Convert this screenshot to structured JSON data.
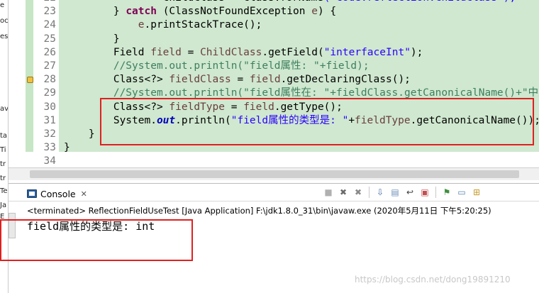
{
  "left_strip": {
    "fragments": [
      "e",
      "oc",
      "es",
      "av",
      "ta",
      "Ti",
      "tr",
      "tr",
      "Te",
      "Ja",
      "E"
    ]
  },
  "editor": {
    "lines": [
      {
        "n": "22",
        "parts": [
          {
            "t": "                ChildClass = Class.",
            "c": ""
          },
          {
            "t": "forName",
            "c": "ital"
          },
          {
            "t": "(\"code.reflection.ChildClass\");",
            "c": "str"
          }
        ]
      },
      {
        "n": "23",
        "parts": [
          {
            "t": "        } ",
            "c": ""
          },
          {
            "t": "catch",
            "c": "kw"
          },
          {
            "t": " (ClassNotFoundException ",
            "c": ""
          },
          {
            "t": "e",
            "c": "var"
          },
          {
            "t": ") {",
            "c": ""
          }
        ]
      },
      {
        "n": "24",
        "parts": [
          {
            "t": "            ",
            "c": ""
          },
          {
            "t": "e",
            "c": "var"
          },
          {
            "t": ".printStackTrace();",
            "c": ""
          }
        ]
      },
      {
        "n": "25",
        "parts": [
          {
            "t": "        }",
            "c": ""
          }
        ]
      },
      {
        "n": "26",
        "parts": [
          {
            "t": "        Field ",
            "c": ""
          },
          {
            "t": "field",
            "c": "var"
          },
          {
            "t": " = ",
            "c": ""
          },
          {
            "t": "ChildClass",
            "c": "var"
          },
          {
            "t": ".getField(",
            "c": ""
          },
          {
            "t": "\"interfaceInt\"",
            "c": "str"
          },
          {
            "t": ");",
            "c": ""
          }
        ]
      },
      {
        "n": "27",
        "parts": [
          {
            "t": "        //System.out.println(\"field属性: \"+field);",
            "c": "cmt"
          }
        ]
      },
      {
        "n": "28",
        "parts": [
          {
            "t": "        Class<?> ",
            "c": ""
          },
          {
            "t": "fieldClass",
            "c": "var"
          },
          {
            "t": " = ",
            "c": ""
          },
          {
            "t": "field",
            "c": "var"
          },
          {
            "t": ".getDeclaringClass();",
            "c": ""
          }
        ]
      },
      {
        "n": "29",
        "parts": [
          {
            "t": "        //System.out.println(\"field属性在: \"+fieldClass.getCanonicalName()+\"中定义\");",
            "c": "cmt"
          }
        ]
      },
      {
        "n": "30",
        "parts": [
          {
            "t": "        Class<?> ",
            "c": ""
          },
          {
            "t": "fieldType",
            "c": "var"
          },
          {
            "t": " = ",
            "c": ""
          },
          {
            "t": "field",
            "c": "var"
          },
          {
            "t": ".getType();",
            "c": ""
          }
        ]
      },
      {
        "n": "31",
        "parts": [
          {
            "t": "        System.",
            "c": ""
          },
          {
            "t": "out",
            "c": "fld"
          },
          {
            "t": ".println(",
            "c": ""
          },
          {
            "t": "\"field属性的类型是: \"",
            "c": "str"
          },
          {
            "t": "+",
            "c": ""
          },
          {
            "t": "fieldType",
            "c": "var"
          },
          {
            "t": ".getCanonicalName());",
            "c": ""
          }
        ]
      },
      {
        "n": "32",
        "parts": [
          {
            "t": "    }",
            "c": ""
          }
        ]
      },
      {
        "n": "33",
        "parts": [
          {
            "t": "}",
            "c": ""
          }
        ]
      },
      {
        "n": "34",
        "parts": [
          {
            "t": "",
            "c": ""
          }
        ]
      }
    ]
  },
  "console": {
    "tab_label": "Console",
    "tab_close": "✕",
    "terminated_text": "<terminated> ReflectionFieldUseTest [Java Application] F:\\jdk1.8.0_31\\bin\\javaw.exe (2020年5月11日 下午5:20:25)",
    "output_text": "field属性的类型是: int",
    "toolbar_icons": [
      {
        "name": "terminate-icon",
        "glyph": "■",
        "color": "#b0b0b0"
      },
      {
        "name": "remove-launch-icon",
        "glyph": "✖",
        "color": "#6b6b6b"
      },
      {
        "name": "remove-all-icon",
        "glyph": "✖",
        "color": "#8a8a8a"
      },
      {
        "name": "scroll-lock-icon",
        "glyph": "⇩",
        "color": "#4a6fa5"
      },
      {
        "name": "clear-console-icon",
        "glyph": "▤",
        "color": "#6d8fb8"
      },
      {
        "name": "word-wrap-icon",
        "glyph": "↩",
        "color": "#3a3a3a"
      },
      {
        "name": "show-on-output-icon",
        "glyph": "▣",
        "color": "#c05050"
      },
      {
        "name": "pin-console-icon",
        "glyph": "⚑",
        "color": "#3f8f3f"
      },
      {
        "name": "display-console-icon",
        "glyph": "▭",
        "color": "#5a7fb0"
      },
      {
        "name": "new-console-icon",
        "glyph": "⊞",
        "color": "#c59a2a"
      }
    ]
  },
  "watermark": "https://blog.csdn.net/dong19891210",
  "colors": {
    "code_bg": "#cfe8cf",
    "highlight_box": "#e02020",
    "keyword": "#7f0055",
    "string": "#2a00ff",
    "comment": "#3f7f5f"
  }
}
